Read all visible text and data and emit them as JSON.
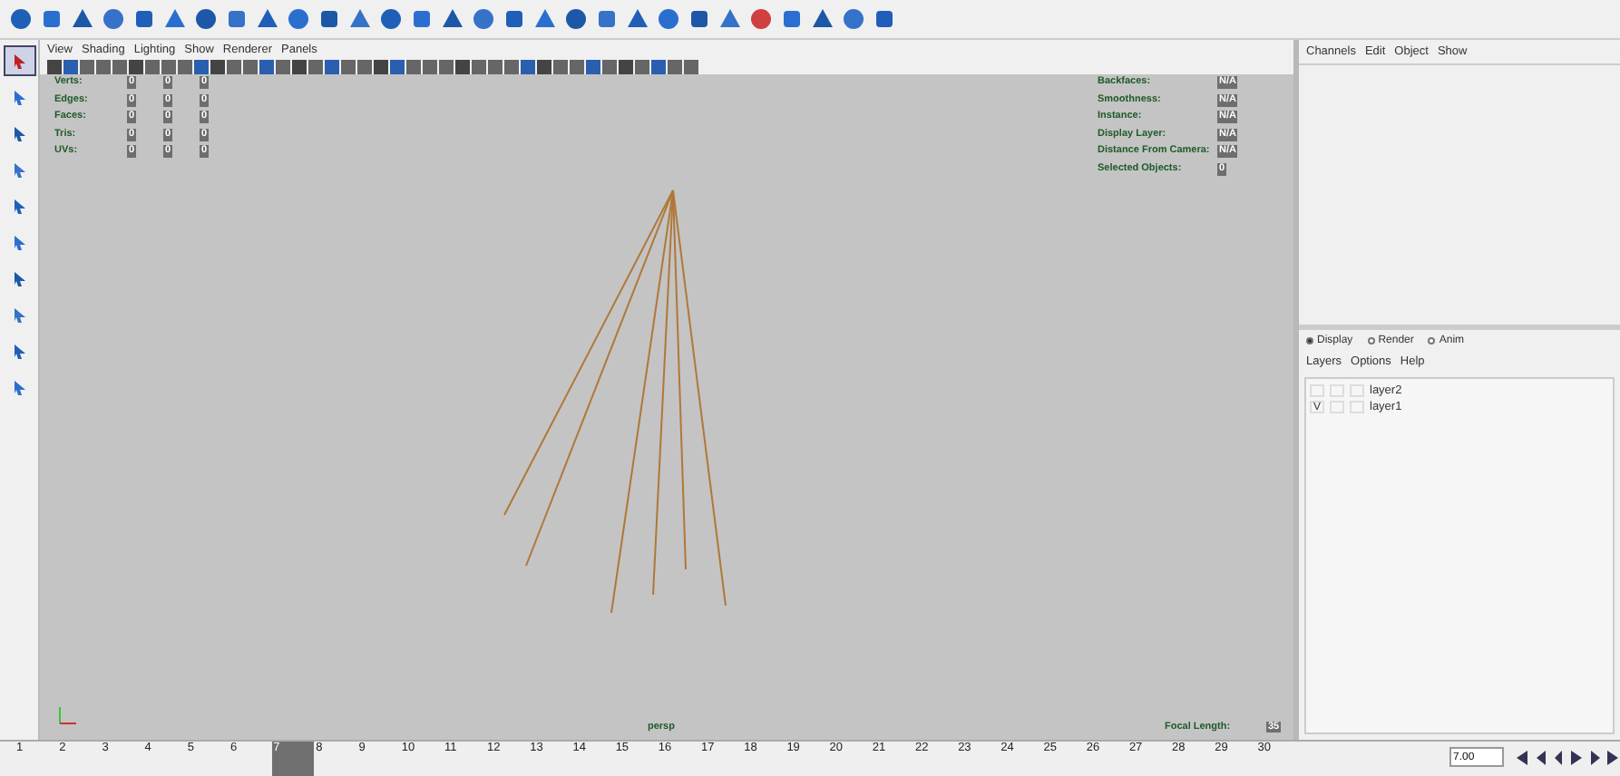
{
  "viewport": {
    "menu": [
      "View",
      "Shading",
      "Lighting",
      "Show",
      "Renderer",
      "Panels"
    ],
    "hud_left": [
      {
        "label": "Verts:",
        "values": [
          "0",
          "0",
          "0"
        ]
      },
      {
        "label": "Edges:",
        "values": [
          "0",
          "0",
          "0"
        ]
      },
      {
        "label": "Faces:",
        "values": [
          "0",
          "0",
          "0"
        ]
      },
      {
        "label": "Tris:",
        "values": [
          "0",
          "0",
          "0"
        ]
      },
      {
        "label": "UVs:",
        "values": [
          "0",
          "0",
          "0"
        ]
      }
    ],
    "hud_right": [
      {
        "label": "Backfaces:",
        "value": "N/A"
      },
      {
        "label": "Smoothness:",
        "value": "N/A"
      },
      {
        "label": "Instance:",
        "value": "N/A"
      },
      {
        "label": "Display Layer:",
        "value": "N/A"
      },
      {
        "label": "Distance From Camera:",
        "value": "N/A"
      },
      {
        "label": "Selected Objects:",
        "value": "0"
      }
    ],
    "camera": "persp",
    "focal_label": "Focal Length:",
    "focal_value": "35"
  },
  "channel_box": {
    "menu": [
      "Channels",
      "Edit",
      "Object",
      "Show"
    ]
  },
  "layer_editor": {
    "modes": [
      {
        "label": "Display",
        "selected": true
      },
      {
        "label": "Render",
        "selected": false
      },
      {
        "label": "Anim",
        "selected": false
      }
    ],
    "menu": [
      "Layers",
      "Options",
      "Help"
    ],
    "layers": [
      {
        "name": "layer2"
      },
      {
        "name": "layer1",
        "visibility": "V"
      }
    ]
  },
  "timeline": {
    "frames": [
      {
        "label": "1",
        "selected": false
      },
      {
        "label": "2",
        "selected": false
      },
      {
        "label": "3",
        "selected": false
      },
      {
        "label": "4",
        "selected": false
      },
      {
        "label": "5",
        "selected": false
      },
      {
        "label": "6",
        "selected": false
      },
      {
        "label": "7",
        "selected": true
      },
      {
        "label": "8",
        "selected": false
      },
      {
        "label": "9",
        "selected": false
      },
      {
        "label": "10",
        "selected": false
      },
      {
        "label": "11",
        "selected": false
      },
      {
        "label": "12",
        "selected": false
      },
      {
        "label": "13",
        "selected": false
      },
      {
        "label": "14",
        "selected": false
      },
      {
        "label": "15",
        "selected": false
      },
      {
        "label": "16",
        "selected": false
      },
      {
        "label": "17",
        "selected": false
      },
      {
        "label": "18",
        "selected": false
      },
      {
        "label": "19",
        "selected": false
      },
      {
        "label": "20",
        "selected": false
      },
      {
        "label": "21",
        "selected": false
      },
      {
        "label": "22",
        "selected": false
      },
      {
        "label": "23",
        "selected": false
      },
      {
        "label": "24",
        "selected": false
      },
      {
        "label": "25",
        "selected": false
      },
      {
        "label": "26",
        "selected": false
      },
      {
        "label": "27",
        "selected": false
      },
      {
        "label": "28",
        "selected": false
      },
      {
        "label": "29",
        "selected": false
      },
      {
        "label": "30",
        "selected": false
      }
    ],
    "current_time": "7.00"
  }
}
